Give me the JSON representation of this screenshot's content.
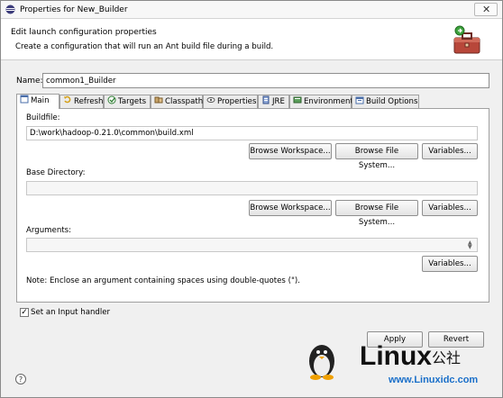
{
  "window": {
    "title": "Properties for New_Builder",
    "close_glyph": "✕"
  },
  "header": {
    "title": "Edit launch configuration properties",
    "description": "Create a configuration that will run an Ant build file during a build.",
    "icon": "toolbox-icon"
  },
  "name_field": {
    "label": "Name:",
    "value": "common1_Builder"
  },
  "tabs": [
    {
      "label": "Main",
      "icon": "main-tab-icon",
      "active": true
    },
    {
      "label": "Refresh",
      "icon": "refresh-icon"
    },
    {
      "label": "Targets",
      "icon": "targets-icon"
    },
    {
      "label": "Classpath",
      "icon": "classpath-icon"
    },
    {
      "label": "Properties",
      "icon": "properties-icon"
    },
    {
      "label": "JRE",
      "icon": "jre-icon"
    },
    {
      "label": "Environment",
      "icon": "environment-icon"
    },
    {
      "label": "Build Options",
      "icon": "build-options-icon"
    }
  ],
  "buildfile": {
    "label": "Buildfile:",
    "value": "D:\\work\\hadoop-0.21.0\\common\\build.xml",
    "browse_workspace": "Browse Workspace...",
    "browse_file_system": "Browse File System...",
    "variables": "Variables..."
  },
  "base_directory": {
    "label": "Base Directory:",
    "value": "",
    "browse_workspace": "Browse Workspace...",
    "browse_file_system": "Browse File System...",
    "variables": "Variables..."
  },
  "arguments": {
    "label": "Arguments:",
    "value": "",
    "variables": "Variables...",
    "note": "Note: Enclose an argument containing spaces using double-quotes (\")."
  },
  "input_handler": {
    "label": "Set an Input handler",
    "checked": true,
    "check_glyph": "✓"
  },
  "footer": {
    "apply": "Apply",
    "revert": "Revert",
    "help_glyph": "?"
  },
  "watermark": {
    "brand": "Linux",
    "brand_suffix": "公社",
    "url": "www.Linuxidc.com"
  }
}
